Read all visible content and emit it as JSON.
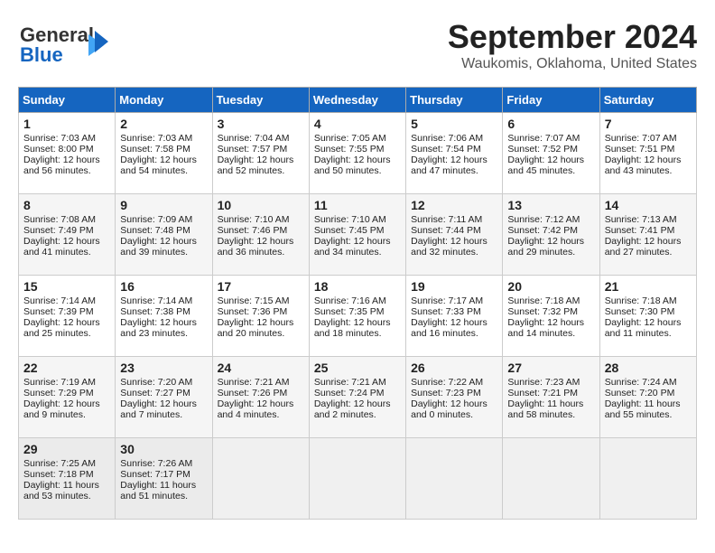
{
  "header": {
    "logo_line1": "General",
    "logo_line2": "Blue",
    "month": "September 2024",
    "location": "Waukomis, Oklahoma, United States"
  },
  "calendar": {
    "days_of_week": [
      "Sunday",
      "Monday",
      "Tuesday",
      "Wednesday",
      "Thursday",
      "Friday",
      "Saturday"
    ],
    "weeks": [
      [
        null,
        {
          "day": 2,
          "sunrise": "7:03 AM",
          "sunset": "7:58 PM",
          "daylight": "12 hours and 54 minutes."
        },
        {
          "day": 3,
          "sunrise": "7:04 AM",
          "sunset": "7:57 PM",
          "daylight": "12 hours and 52 minutes."
        },
        {
          "day": 4,
          "sunrise": "7:05 AM",
          "sunset": "7:55 PM",
          "daylight": "12 hours and 50 minutes."
        },
        {
          "day": 5,
          "sunrise": "7:06 AM",
          "sunset": "7:54 PM",
          "daylight": "12 hours and 47 minutes."
        },
        {
          "day": 6,
          "sunrise": "7:07 AM",
          "sunset": "7:52 PM",
          "daylight": "12 hours and 45 minutes."
        },
        {
          "day": 7,
          "sunrise": "7:07 AM",
          "sunset": "7:51 PM",
          "daylight": "12 hours and 43 minutes."
        }
      ],
      [
        {
          "day": 1,
          "sunrise": "7:03 AM",
          "sunset": "8:00 PM",
          "daylight": "12 hours and 56 minutes."
        },
        {
          "day": 9,
          "sunrise": "7:09 AM",
          "sunset": "7:48 PM",
          "daylight": "12 hours and 39 minutes."
        },
        {
          "day": 10,
          "sunrise": "7:10 AM",
          "sunset": "7:46 PM",
          "daylight": "12 hours and 36 minutes."
        },
        {
          "day": 11,
          "sunrise": "7:10 AM",
          "sunset": "7:45 PM",
          "daylight": "12 hours and 34 minutes."
        },
        {
          "day": 12,
          "sunrise": "7:11 AM",
          "sunset": "7:44 PM",
          "daylight": "12 hours and 32 minutes."
        },
        {
          "day": 13,
          "sunrise": "7:12 AM",
          "sunset": "7:42 PM",
          "daylight": "12 hours and 29 minutes."
        },
        {
          "day": 14,
          "sunrise": "7:13 AM",
          "sunset": "7:41 PM",
          "daylight": "12 hours and 27 minutes."
        }
      ],
      [
        {
          "day": 8,
          "sunrise": "7:08 AM",
          "sunset": "7:49 PM",
          "daylight": "12 hours and 41 minutes."
        },
        {
          "day": 16,
          "sunrise": "7:14 AM",
          "sunset": "7:38 PM",
          "daylight": "12 hours and 23 minutes."
        },
        {
          "day": 17,
          "sunrise": "7:15 AM",
          "sunset": "7:36 PM",
          "daylight": "12 hours and 20 minutes."
        },
        {
          "day": 18,
          "sunrise": "7:16 AM",
          "sunset": "7:35 PM",
          "daylight": "12 hours and 18 minutes."
        },
        {
          "day": 19,
          "sunrise": "7:17 AM",
          "sunset": "7:33 PM",
          "daylight": "12 hours and 16 minutes."
        },
        {
          "day": 20,
          "sunrise": "7:18 AM",
          "sunset": "7:32 PM",
          "daylight": "12 hours and 14 minutes."
        },
        {
          "day": 21,
          "sunrise": "7:18 AM",
          "sunset": "7:30 PM",
          "daylight": "12 hours and 11 minutes."
        }
      ],
      [
        {
          "day": 15,
          "sunrise": "7:14 AM",
          "sunset": "7:39 PM",
          "daylight": "12 hours and 25 minutes."
        },
        {
          "day": 23,
          "sunrise": "7:20 AM",
          "sunset": "7:27 PM",
          "daylight": "12 hours and 7 minutes."
        },
        {
          "day": 24,
          "sunrise": "7:21 AM",
          "sunset": "7:26 PM",
          "daylight": "12 hours and 4 minutes."
        },
        {
          "day": 25,
          "sunrise": "7:21 AM",
          "sunset": "7:24 PM",
          "daylight": "12 hours and 2 minutes."
        },
        {
          "day": 26,
          "sunrise": "7:22 AM",
          "sunset": "7:23 PM",
          "daylight": "12 hours and 0 minutes."
        },
        {
          "day": 27,
          "sunrise": "7:23 AM",
          "sunset": "7:21 PM",
          "daylight": "11 hours and 58 minutes."
        },
        {
          "day": 28,
          "sunrise": "7:24 AM",
          "sunset": "7:20 PM",
          "daylight": "11 hours and 55 minutes."
        }
      ],
      [
        {
          "day": 22,
          "sunrise": "7:19 AM",
          "sunset": "7:29 PM",
          "daylight": "12 hours and 9 minutes."
        },
        {
          "day": 30,
          "sunrise": "7:26 AM",
          "sunset": "7:17 PM",
          "daylight": "11 hours and 51 minutes."
        },
        null,
        null,
        null,
        null,
        null
      ],
      [
        {
          "day": 29,
          "sunrise": "7:25 AM",
          "sunset": "7:18 PM",
          "daylight": "11 hours and 53 minutes."
        },
        null,
        null,
        null,
        null,
        null,
        null
      ]
    ]
  }
}
